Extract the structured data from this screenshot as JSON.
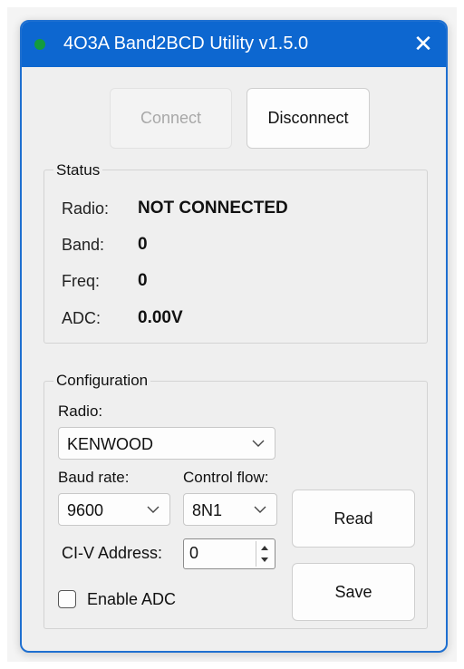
{
  "window": {
    "title": "4O3A Band2BCD Utility v1.5.0",
    "close_symbol": "✕",
    "accent": "#0d67d0",
    "status_dot_color": "#139b3d"
  },
  "toolbar": {
    "connect_label": "Connect",
    "disconnect_label": "Disconnect"
  },
  "status": {
    "legend": "Status",
    "rows": [
      {
        "label": "Radio:",
        "value": "NOT CONNECTED"
      },
      {
        "label": "Band:",
        "value": "0"
      },
      {
        "label": "Freq:",
        "value": "0"
      },
      {
        "label": "ADC:",
        "value": "0.00V"
      }
    ]
  },
  "configuration": {
    "legend": "Configuration",
    "radio_label": "Radio:",
    "radio_value": "KENWOOD",
    "baud_label": "Baud rate:",
    "baud_value": "9600",
    "flow_label": "Control flow:",
    "flow_value": "8N1",
    "civ_label": "CI-V Address:",
    "civ_value": "0",
    "enable_adc_label": "Enable ADC",
    "read_label": "Read",
    "save_label": "Save"
  }
}
